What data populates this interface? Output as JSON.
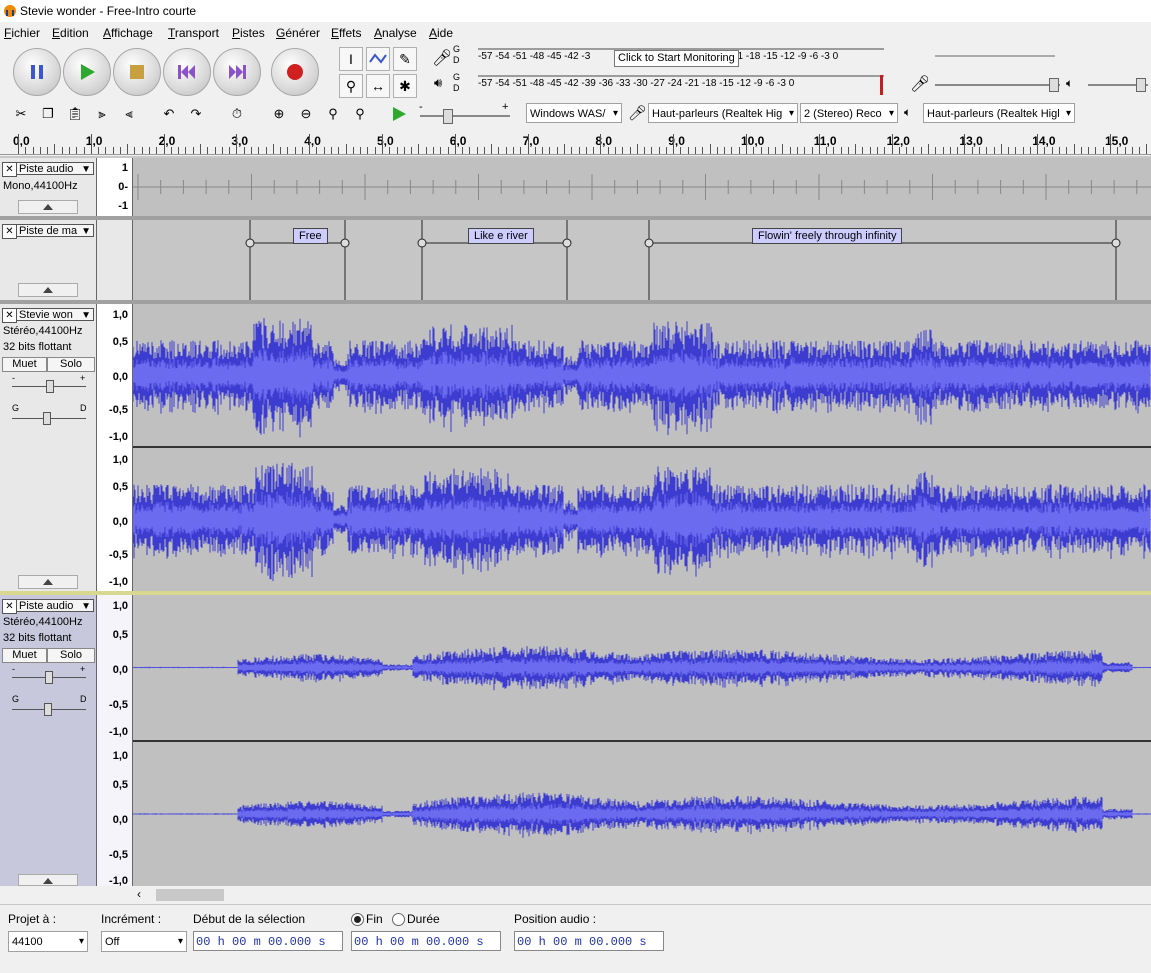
{
  "window": {
    "title": "Stevie wonder - Free-Intro courte"
  },
  "menu": [
    {
      "label": "Fichier",
      "u": "F",
      "rest": "ichier"
    },
    {
      "label": "Edition",
      "u": "E",
      "rest": "dition"
    },
    {
      "label": "Affichage",
      "u": "A",
      "rest": "ffichage"
    },
    {
      "label": "Transport",
      "u": "T",
      "rest": "ransport"
    },
    {
      "label": "Pistes",
      "u": "P",
      "rest": "istes"
    },
    {
      "label": "Générer",
      "u": "G",
      "rest": "énérer"
    },
    {
      "label": "Effets",
      "u": "E",
      "rest": "ffets"
    },
    {
      "label": "Analyse",
      "u": "A",
      "rest": "nalyse"
    },
    {
      "label": "Aide",
      "u": "A",
      "rest": "ide"
    }
  ],
  "meters": {
    "record_scale": "-57 -54 -51 -48 -45 -42 -3",
    "record_scale_tail": "21 -18 -15 -12  -9  -6  -3  0",
    "playback_scale": "-57 -54 -51 -48 -45 -42 -39 -36 -33 -30 -27 -24 -21 -18 -15 -12  -9  -6  -3  0",
    "monitor_tip": "Click to Start Monitoring",
    "gd_top": "G",
    "gd_bottom": "D"
  },
  "devices": {
    "host": "Windows WAS/",
    "input": "Haut-parleurs (Realtek Hig",
    "channels": "2 (Stereo) Reco",
    "output": "Haut-parleurs (Realtek Higl"
  },
  "slider": {
    "minus": "-",
    "plus": "+"
  },
  "ruler": {
    "labels": [
      "0,0",
      "1,0",
      "2,0",
      "3,0",
      "4,0",
      "5,0",
      "6,0",
      "7,0",
      "8,0",
      "9,0",
      "10,0",
      "11,0",
      "12,0",
      "13,0",
      "14,0",
      "15,0"
    ]
  },
  "tracks": {
    "t1": {
      "name": "Piste audio",
      "info1": "Mono,44100Hz",
      "scale": [
        "1",
        "0-",
        "-1"
      ]
    },
    "t2": {
      "name": "Piste de ma",
      "labels": [
        "Free",
        "Like e river",
        "Flowin' freely through infinity"
      ]
    },
    "t3": {
      "name": "Stevie won",
      "info1": "Stéréo,44100Hz",
      "info2": "32 bits flottant",
      "mute": "Muet",
      "solo": "Solo",
      "scale": [
        "1,0",
        "0,5",
        "0,0",
        "-0,5",
        "-1,0"
      ],
      "gain_minus": "-",
      "gain_plus": "+",
      "pan_left": "G",
      "pan_right": "D"
    },
    "t4": {
      "name": "Piste audio",
      "info1": "Stéréo,44100Hz",
      "info2": "32 bits flottant",
      "mute": "Muet",
      "solo": "Solo",
      "scale": [
        "1,0",
        "0,5",
        "0,0",
        "-0,5",
        "-1,0"
      ],
      "gain_minus": "-",
      "gain_plus": "+",
      "pan_left": "G",
      "pan_right": "D"
    }
  },
  "status": {
    "project_rate_label": "Projet à :",
    "project_rate": "44100",
    "snap_label": "Incrément :",
    "snap_value": "Off",
    "selection_start_label": "Début de la sélection",
    "end_label": "Fin",
    "duration_label": "Durée",
    "audio_pos_label": "Position audio :",
    "sel_start": "00 h 00 m 00.000 s",
    "sel_end": "00 h 00 m 00.000 s",
    "audio_pos": "00 h 00 m 00.000 s"
  },
  "colors": {
    "wave": "#3c3cd0",
    "wave_rms": "#6b6bf0",
    "label_fill": "#ccccff"
  }
}
